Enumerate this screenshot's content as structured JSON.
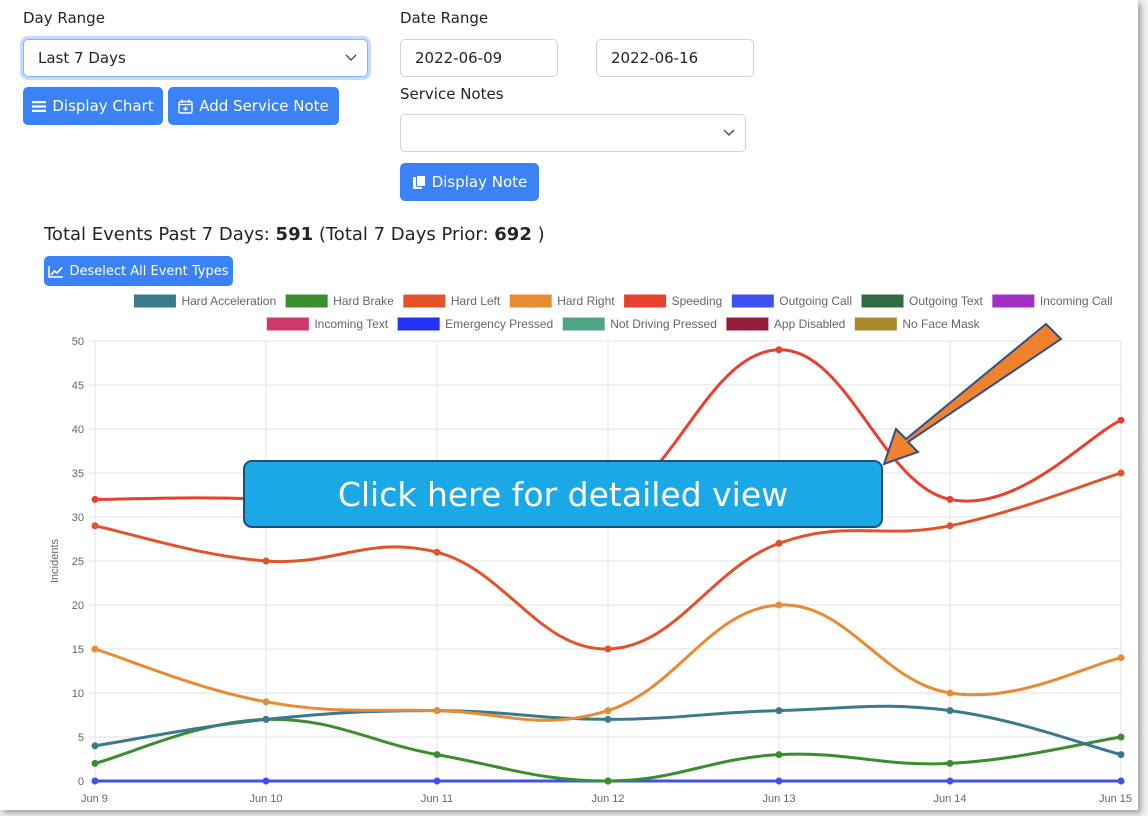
{
  "controls": {
    "day_range_label": "Day Range",
    "day_range_value": "Last 7 Days",
    "date_range_label": "Date Range",
    "date_start": "2022-06-09",
    "date_end": "2022-06-16",
    "service_notes_label": "Service Notes",
    "service_notes_value": "",
    "display_chart_button": "Display Chart",
    "add_service_note_button": "Add Service Note",
    "display_note_button": "Display Note",
    "deselect_button": "Deselect All Event Types"
  },
  "summary": {
    "prefix": "Total Events Past 7 Days: ",
    "total": "591",
    "prior_prefix": " (Total 7 Days Prior: ",
    "prior_total": "692",
    "suffix": " )"
  },
  "callout": {
    "text": "Click here for detailed view"
  },
  "colors": {
    "button": "#3b82f6",
    "callout_fill": "#1aa9e6",
    "arrow": "#f0812d"
  },
  "chart_data": {
    "type": "line",
    "ylabel": "Incidents",
    "xlabel": "",
    "ylim": [
      0,
      50
    ],
    "yticks": [
      0,
      5,
      10,
      15,
      20,
      25,
      30,
      35,
      40,
      45,
      50
    ],
    "grid": true,
    "legend_position": "top",
    "categories": [
      "Jun 9",
      "Jun 10",
      "Jun 11",
      "Jun 12",
      "Jun 13",
      "Jun 14",
      "Jun 15"
    ],
    "legend": [
      {
        "name": "Hard Acceleration",
        "color": "#3a7a8c"
      },
      {
        "name": "Hard Brake",
        "color": "#3b8e30"
      },
      {
        "name": "Hard Left",
        "color": "#e2532a"
      },
      {
        "name": "Hard Right",
        "color": "#e98a35"
      },
      {
        "name": "Speeding",
        "color": "#e8412f"
      },
      {
        "name": "Outgoing Call",
        "color": "#3f51f0"
      },
      {
        "name": "Outgoing Text",
        "color": "#2f6b45"
      },
      {
        "name": "Incoming Call",
        "color": "#a42fc4"
      },
      {
        "name": "Incoming Text",
        "color": "#d2376a"
      },
      {
        "name": "Emergency Pressed",
        "color": "#2432f5"
      },
      {
        "name": "Not Driving Pressed",
        "color": "#4ea584"
      },
      {
        "name": "App Disabled",
        "color": "#941d3a"
      },
      {
        "name": "No Face Mask",
        "color": "#a88a2b"
      }
    ],
    "series": [
      {
        "name": "Outgoing Call",
        "color": "#3f51f0",
        "values": [
          0,
          0,
          0,
          0,
          0,
          0,
          0
        ]
      },
      {
        "name": "Hard Brake",
        "color": "#3b8e30",
        "values": [
          2,
          7,
          3,
          0,
          3,
          2,
          5
        ]
      },
      {
        "name": "Hard Acceleration",
        "color": "#3a7a8c",
        "values": [
          4,
          7,
          8,
          7,
          8,
          8,
          3
        ]
      },
      {
        "name": "Hard Right",
        "color": "#e98a35",
        "values": [
          15,
          9,
          8,
          8,
          20,
          10,
          14
        ]
      },
      {
        "name": "Hard Left",
        "color": "#e2532a",
        "values": [
          29,
          25,
          26,
          15,
          27,
          29,
          35
        ]
      },
      {
        "name": "Speeding",
        "color": "#e8412f",
        "values": [
          32,
          32,
          30,
          31,
          49,
          32,
          41
        ]
      }
    ]
  }
}
